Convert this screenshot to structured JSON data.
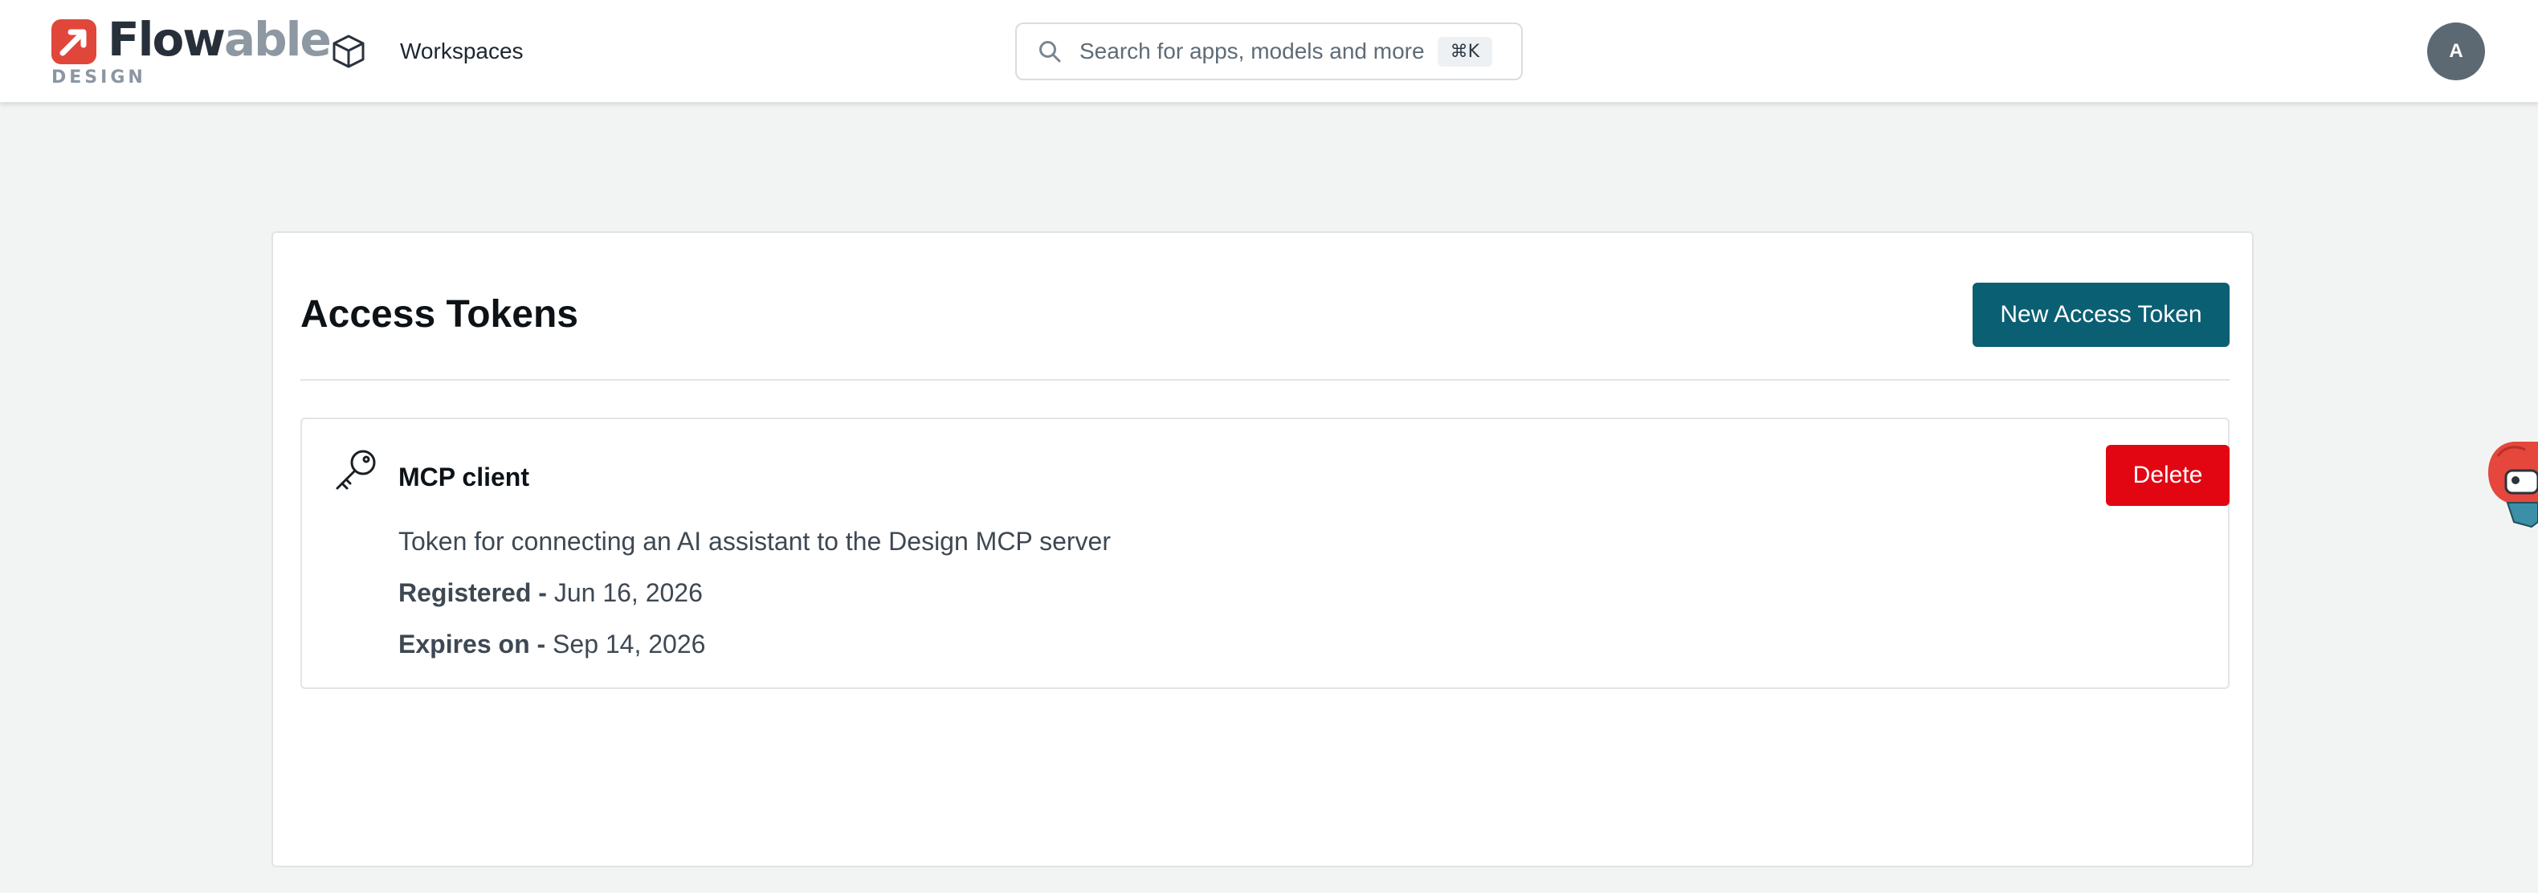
{
  "brand": {
    "logo_text_primary": "Flow",
    "logo_text_secondary": "able",
    "logo_subtitle": "DESIGN",
    "accent_color": "#e0473a"
  },
  "nav": {
    "workspaces_label": "Workspaces",
    "workspaces_icon": "cube-icon"
  },
  "search": {
    "placeholder": "Search for apps, models and more",
    "shortcut": "⌘K",
    "icon": "search-icon"
  },
  "user": {
    "avatar_initial": "A"
  },
  "page": {
    "title": "Access Tokens",
    "new_token_label": "New Access Token",
    "primary_color": "#0b5f73"
  },
  "tokens": [
    {
      "name": "MCP client",
      "icon": "key-icon",
      "description": "Token for connecting an AI assistant to the Design MCP server",
      "registered_label": "Registered -",
      "registered_value": "Jun 16, 2026",
      "expires_label": "Expires on -",
      "expires_value": "Sep 14, 2026",
      "delete_label": "Delete",
      "delete_color": "#e20613"
    }
  ]
}
